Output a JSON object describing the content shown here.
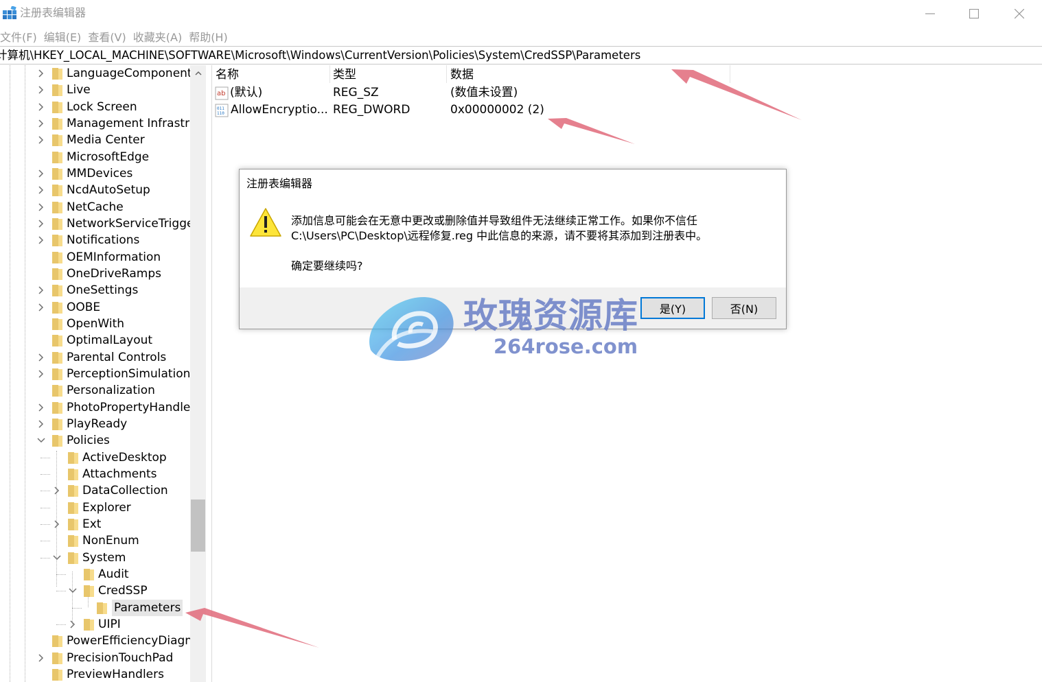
{
  "window": {
    "title": "注册表编辑器",
    "controls": {
      "minimize": "minimize-icon",
      "maximize": "maximize-icon",
      "close": "close-icon"
    }
  },
  "menu": [
    "文件(F)",
    "编辑(E)",
    "查看(V)",
    "收藏夹(A)",
    "帮助(H)"
  ],
  "address": "计算机\\HKEY_LOCAL_MACHINE\\SOFTWARE\\Microsoft\\Windows\\CurrentVersion\\Policies\\System\\CredSSP\\Parameters",
  "tree": {
    "items": [
      {
        "label": "LanguageComponents",
        "state": "collapsed"
      },
      {
        "label": "Live",
        "state": "collapsed"
      },
      {
        "label": "Lock Screen",
        "state": "collapsed"
      },
      {
        "label": "Management Infrastructure",
        "state": "collapsed"
      },
      {
        "label": "Media Center",
        "state": "collapsed"
      },
      {
        "label": "MicrosoftEdge",
        "state": "leaf"
      },
      {
        "label": "MMDevices",
        "state": "collapsed"
      },
      {
        "label": "NcdAutoSetup",
        "state": "collapsed"
      },
      {
        "label": "NetCache",
        "state": "collapsed"
      },
      {
        "label": "NetworkServiceTriggers",
        "state": "collapsed"
      },
      {
        "label": "Notifications",
        "state": "collapsed"
      },
      {
        "label": "OEMInformation",
        "state": "leaf"
      },
      {
        "label": "OneDriveRamps",
        "state": "leaf"
      },
      {
        "label": "OneSettings",
        "state": "collapsed"
      },
      {
        "label": "OOBE",
        "state": "collapsed"
      },
      {
        "label": "OpenWith",
        "state": "leaf"
      },
      {
        "label": "OptimalLayout",
        "state": "leaf"
      },
      {
        "label": "Parental Controls",
        "state": "collapsed"
      },
      {
        "label": "PerceptionSimulationExtensions",
        "state": "collapsed"
      },
      {
        "label": "Personalization",
        "state": "leaf"
      },
      {
        "label": "PhotoPropertyHandler",
        "state": "collapsed"
      },
      {
        "label": "PlayReady",
        "state": "collapsed"
      },
      {
        "label": "Policies",
        "state": "expanded"
      },
      {
        "label": "ActiveDesktop",
        "state": "leaf"
      },
      {
        "label": "Attachments",
        "state": "leaf"
      },
      {
        "label": "DataCollection",
        "state": "collapsed"
      },
      {
        "label": "Explorer",
        "state": "leaf"
      },
      {
        "label": "Ext",
        "state": "collapsed"
      },
      {
        "label": "NonEnum",
        "state": "leaf"
      },
      {
        "label": "System",
        "state": "expanded"
      },
      {
        "label": "Audit",
        "state": "leaf"
      },
      {
        "label": "CredSSP",
        "state": "expanded"
      },
      {
        "label": "Parameters",
        "state": "selected"
      },
      {
        "label": "UIPI",
        "state": "collapsed"
      },
      {
        "label": "PowerEfficiencyDiagnostics",
        "state": "leaf"
      },
      {
        "label": "PrecisionTouchPad",
        "state": "collapsed"
      },
      {
        "label": "PreviewHandlers",
        "state": "leaf"
      }
    ]
  },
  "values_pane": {
    "columns": [
      "名称",
      "类型",
      "数据"
    ],
    "rows": [
      {
        "icon": "string-value-icon",
        "name": "(默认)",
        "type": "REG_SZ",
        "data": "(数值未设置)"
      },
      {
        "icon": "binary-value-icon",
        "name": "AllowEncryptio...",
        "type": "REG_DWORD",
        "data": "0x00000002 (2)"
      }
    ]
  },
  "dialog": {
    "title": "注册表编辑器",
    "icon": "warning-icon",
    "message_line1": "添加信息可能会在无意中更改或删除值并导致组件无法继续正常工作。如果你不信任",
    "message_line2": "C:\\Users\\PC\\Desktop\\远程修复.reg 中此信息的来源，请不要将其添加到注册表中。",
    "question": "确定要继续吗?",
    "yes_label": "是(Y)",
    "no_label": "否(N)"
  },
  "watermark": {
    "text": "玫瑰资源库",
    "url": "264rose.com"
  },
  "colors": {
    "selection": "#e5e5e5",
    "accent_button_border": "#0078d7",
    "arrow": "#e06a7a",
    "folder": "#f7dc8c"
  }
}
